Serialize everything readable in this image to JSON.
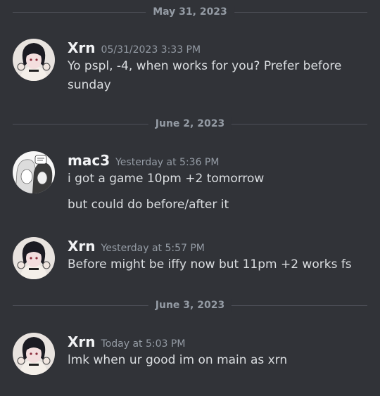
{
  "dividers": [
    {
      "label": "May 31, 2023"
    },
    {
      "label": "June 2, 2023"
    },
    {
      "label": "June 3, 2023"
    }
  ],
  "messages": [
    {
      "username": "Xrn",
      "timestamp": "05/31/2023 3:33 PM",
      "lines": [
        "Yo pspl, -4, when works for you? Prefer before sunday"
      ],
      "avatar": "anime-avatar-icon"
    },
    {
      "username": "mac3",
      "timestamp": "Yesterday at 5:36 PM",
      "lines": [
        "i got a game 10pm +2 tomorrow",
        "but could do before/after it"
      ],
      "avatar": "manga-avatar-icon"
    },
    {
      "username": "Xrn",
      "timestamp": "Yesterday at 5:57 PM",
      "lines": [
        "Before might be iffy now but 11pm +2 works fs"
      ],
      "avatar": "anime-avatar-icon"
    },
    {
      "username": "Xrn",
      "timestamp": "Today at 5:03 PM",
      "lines": [
        "lmk when ur good im on main as xrn"
      ],
      "avatar": "anime-avatar-icon"
    }
  ],
  "colors": {
    "background": "#313338",
    "username": "#f2f3f5",
    "muted": "#949ba4",
    "text": "#dbdee1",
    "divider": "#4e5058"
  }
}
